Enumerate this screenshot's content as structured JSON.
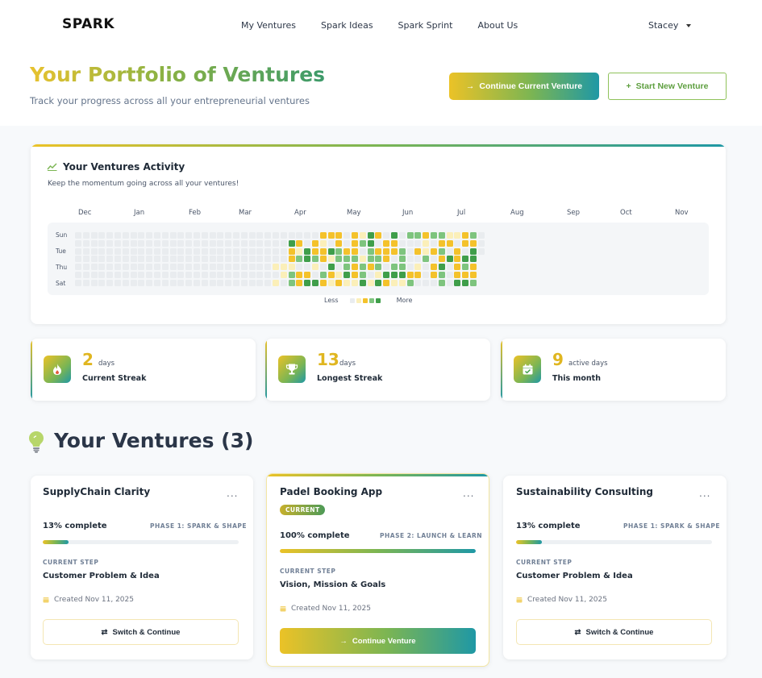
{
  "brand": {
    "logo": "SPARK"
  },
  "nav": {
    "items": [
      "My Ventures",
      "Spark Ideas",
      "Spark Sprint",
      "About Us"
    ],
    "user": "Stacey"
  },
  "hero": {
    "title": "Your Portfolio of Ventures",
    "subtitle": "Track your progress across all your entrepreneurial ventures",
    "continue_label": "Continue Current Venture",
    "new_label": "Start New Venture"
  },
  "activity": {
    "title": "Your Ventures Activity",
    "subtitle": "Keep the momentum going across all your ventures!",
    "months": [
      "Dec",
      "Jan",
      "Feb",
      "Mar",
      "Apr",
      "May",
      "Jun",
      "Jul",
      "Aug",
      "Sep",
      "Oct",
      "Nov"
    ],
    "days": [
      "Sun",
      "Tue",
      "Thu",
      "Sat"
    ],
    "legend_less": "Less",
    "legend_more": "More",
    "colors": {
      "empty": "#e9ecef",
      "l1": "#fbefb9",
      "l2": "#f4c22b",
      "l3": "#7ec47e",
      "l4": "#3f9e4a"
    }
  },
  "stats": [
    {
      "value": "2",
      "unit": "days",
      "label": "Current Streak",
      "icon": "flame-icon"
    },
    {
      "value": "13",
      "unit": "days",
      "label": "Longest Streak",
      "icon": "trophy-icon"
    },
    {
      "value": "9",
      "unit": "active days",
      "label": "This month",
      "icon": "calendar-check-icon"
    }
  ],
  "ventures_heading": "Your Ventures (3)",
  "ventures": [
    {
      "name": "SupplyChain Clarity",
      "badge": "",
      "progress_label": "13% complete",
      "progress": 0.13,
      "phase": "PHASE 1: SPARK & SHAPE",
      "current_step_label": "CURRENT STEP",
      "current_step": "Customer Problem & Idea",
      "created": "Created Nov 11, 2025",
      "button": "Switch & Continue"
    },
    {
      "name": "Padel Booking App",
      "badge": "CURRENT",
      "progress_label": "100% complete",
      "progress": 1.0,
      "phase": "PHASE 2: LAUNCH & LEARN",
      "current_step_label": "CURRENT STEP",
      "current_step": "Vision, Mission & Goals",
      "created": "Created Nov 11, 2025",
      "button": "Continue Venture"
    },
    {
      "name": "Sustainability Consulting",
      "badge": "",
      "progress_label": "13% complete",
      "progress": 0.13,
      "phase": "PHASE 1: SPARK & SHAPE",
      "current_step_label": "CURRENT STEP",
      "current_step": "Customer Problem & Idea",
      "created": "Created Nov 11, 2025",
      "button": "Switch & Continue"
    }
  ]
}
